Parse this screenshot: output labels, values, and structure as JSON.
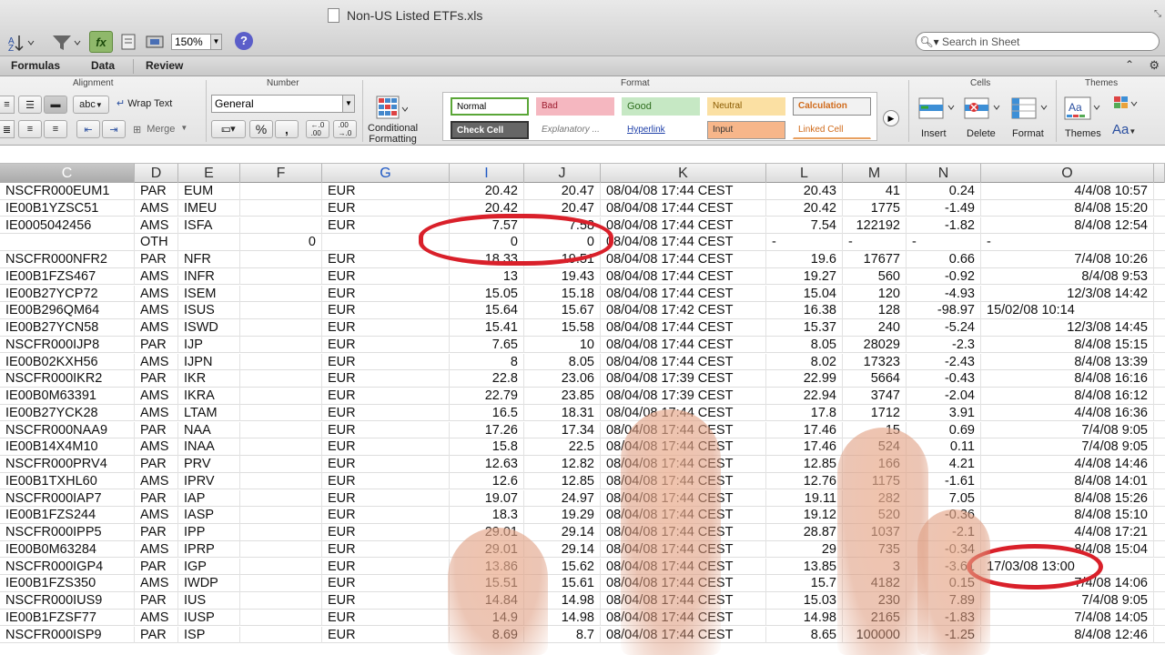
{
  "window": {
    "title": "Non-US Listed ETFs.xls"
  },
  "toolbar": {
    "zoom": "150%",
    "help": "?"
  },
  "search": {
    "placeholder": "Search in Sheet"
  },
  "tabs": [
    "Formulas",
    "Data",
    "Review"
  ],
  "ribbon": {
    "groups": {
      "alignment": "Alignment",
      "number": "Number",
      "format": "Format",
      "cells": "Cells",
      "themes": "Themes"
    },
    "wrap_text": "Wrap Text",
    "merge": "Merge",
    "abc": "abc",
    "number_format": "General",
    "percent": "%",
    "comma": ",",
    "conditional_formatting": [
      "Conditional",
      "Formatting"
    ],
    "styles": {
      "normal": "Normal",
      "bad": "Bad",
      "good": "Good",
      "neutral": "Neutral",
      "calculation": "Calculation",
      "check_cell": "Check Cell",
      "explanatory": "Explanatory ...",
      "hyperlink": "Hyperlink",
      "input": "Input",
      "linked_cell": "Linked Cell"
    },
    "insert": "Insert",
    "delete": "Delete",
    "format_btn": "Format",
    "themes_btn": "Themes",
    "fonts_btn": "Aa"
  },
  "columns": [
    "C",
    "D",
    "E",
    "F",
    "G",
    "I",
    "J",
    "K",
    "L",
    "M",
    "N",
    "O"
  ],
  "rows": [
    [
      "NSCFR000EUM1",
      "PAR",
      "EUM",
      "",
      "EUR",
      "20.42",
      "20.47",
      "08/04/08 17:44 CEST",
      "20.43",
      "41",
      "0.24",
      "4/4/08 10:57"
    ],
    [
      "IE00B1YZSC51",
      "AMS",
      "IMEU",
      "",
      "EUR",
      "20.42",
      "20.47",
      "08/04/08 17:44 CEST",
      "20.42",
      "1775",
      "-1.49",
      "8/4/08 15:20"
    ],
    [
      "IE0005042456",
      "AMS",
      "ISFA",
      "",
      "EUR",
      "7.57",
      "7.58",
      "08/04/08 17:44 CEST",
      "7.54",
      "122192",
      "-1.82",
      "8/4/08 12:54"
    ],
    [
      "",
      "OTH",
      "",
      "0",
      "",
      "0",
      "0",
      "08/04/08 17:44 CEST",
      "-",
      "-",
      "-",
      "-"
    ],
    [
      "NSCFR000NFR2",
      "PAR",
      "NFR",
      "",
      "EUR",
      "18.33",
      "19.51",
      "08/04/08 17:44 CEST",
      "19.6",
      "17677",
      "0.66",
      "7/4/08 10:26"
    ],
    [
      "IE00B1FZS467",
      "AMS",
      "INFR",
      "",
      "EUR",
      "13",
      "19.43",
      "08/04/08 17:44 CEST",
      "19.27",
      "560",
      "-0.92",
      "8/4/08 9:53"
    ],
    [
      "IE00B27YCP72",
      "AMS",
      "ISEM",
      "",
      "EUR",
      "15.05",
      "15.18",
      "08/04/08 17:44 CEST",
      "15.04",
      "120",
      "-4.93",
      "12/3/08 14:42"
    ],
    [
      "IE00B296QM64",
      "AMS",
      "ISUS",
      "",
      "EUR",
      "15.64",
      "15.67",
      "08/04/08 17:42 CEST",
      "16.38",
      "128",
      "-98.97",
      "15/02/08 10:14"
    ],
    [
      "IE00B27YCN58",
      "AMS",
      "ISWD",
      "",
      "EUR",
      "15.41",
      "15.58",
      "08/04/08 17:44 CEST",
      "15.37",
      "240",
      "-5.24",
      "12/3/08 14:45"
    ],
    [
      "NSCFR000IJP8",
      "PAR",
      "IJP",
      "",
      "EUR",
      "7.65",
      "10",
      "08/04/08 17:44 CEST",
      "8.05",
      "28029",
      "-2.3",
      "8/4/08 15:15"
    ],
    [
      "IE00B02KXH56",
      "AMS",
      "IJPN",
      "",
      "EUR",
      "8",
      "8.05",
      "08/04/08 17:44 CEST",
      "8.02",
      "17323",
      "-2.43",
      "8/4/08 13:39"
    ],
    [
      "NSCFR000IKR2",
      "PAR",
      "IKR",
      "",
      "EUR",
      "22.8",
      "23.06",
      "08/04/08 17:39 CEST",
      "22.99",
      "5664",
      "-0.43",
      "8/4/08 16:16"
    ],
    [
      "IE00B0M63391",
      "AMS",
      "IKRA",
      "",
      "EUR",
      "22.79",
      "23.85",
      "08/04/08 17:39 CEST",
      "22.94",
      "3747",
      "-2.04",
      "8/4/08 16:12"
    ],
    [
      "IE00B27YCK28",
      "AMS",
      "LTAM",
      "",
      "EUR",
      "16.5",
      "18.31",
      "08/04/08 17:44 CEST",
      "17.8",
      "1712",
      "3.91",
      "4/4/08 16:36"
    ],
    [
      "NSCFR000NAA9",
      "PAR",
      "NAA",
      "",
      "EUR",
      "17.26",
      "17.34",
      "08/04/08 17:44 CEST",
      "17.46",
      "15",
      "0.69",
      "7/4/08 9:05"
    ],
    [
      "IE00B14X4M10",
      "AMS",
      "INAA",
      "",
      "EUR",
      "15.8",
      "22.5",
      "08/04/08 17:44 CEST",
      "17.46",
      "524",
      "0.11",
      "7/4/08 9:05"
    ],
    [
      "NSCFR000PRV4",
      "PAR",
      "PRV",
      "",
      "EUR",
      "12.63",
      "12.82",
      "08/04/08 17:44 CEST",
      "12.85",
      "166",
      "4.21",
      "4/4/08 14:46"
    ],
    [
      "IE00B1TXHL60",
      "AMS",
      "IPRV",
      "",
      "EUR",
      "12.6",
      "12.85",
      "08/04/08 17:44 CEST",
      "12.76",
      "1175",
      "-1.61",
      "8/4/08 14:01"
    ],
    [
      "NSCFR000IAP7",
      "PAR",
      "IAP",
      "",
      "EUR",
      "19.07",
      "24.97",
      "08/04/08 17:44 CEST",
      "19.11",
      "282",
      "7.05",
      "8/4/08 15:26"
    ],
    [
      "IE00B1FZS244",
      "AMS",
      "IASP",
      "",
      "EUR",
      "18.3",
      "19.29",
      "08/04/08 17:44 CEST",
      "19.12",
      "520",
      "-0.36",
      "8/4/08 15:10"
    ],
    [
      "NSCFR000IPP5",
      "PAR",
      "IPP",
      "",
      "EUR",
      "29.01",
      "29.14",
      "08/04/08 17:44 CEST",
      "28.87",
      "1037",
      "-2.1",
      "4/4/08 17:21"
    ],
    [
      "IE00B0M63284",
      "AMS",
      "IPRP",
      "",
      "EUR",
      "29.01",
      "29.14",
      "08/04/08 17:44 CEST",
      "29",
      "735",
      "-0.34",
      "8/4/08 15:04"
    ],
    [
      "NSCFR000IGP4",
      "PAR",
      "IGP",
      "",
      "EUR",
      "13.86",
      "15.62",
      "08/04/08 17:44 CEST",
      "13.85",
      "3",
      "-3.61",
      "17/03/08 13:00"
    ],
    [
      "IE00B1FZS350",
      "AMS",
      "IWDP",
      "",
      "EUR",
      "15.51",
      "15.61",
      "08/04/08 17:44 CEST",
      "15.7",
      "4182",
      "0.15",
      "7/4/08 14:06"
    ],
    [
      "NSCFR000IUS9",
      "PAR",
      "IUS",
      "",
      "EUR",
      "14.84",
      "14.98",
      "08/04/08 17:44 CEST",
      "15.03",
      "230",
      "7.89",
      "7/4/08 9:05"
    ],
    [
      "IE00B1FZSF77",
      "AMS",
      "IUSP",
      "",
      "EUR",
      "14.9",
      "14.98",
      "08/04/08 17:44 CEST",
      "14.98",
      "2165",
      "-1.83",
      "7/4/08 14:05"
    ],
    [
      "NSCFR000ISP9",
      "PAR",
      "ISP",
      "",
      "EUR",
      "8.69",
      "8.7",
      "08/04/08 17:44 CEST",
      "8.65",
      "100000",
      "-1.25",
      "8/4/08 12:46"
    ]
  ],
  "colors": {
    "annotation": "#d9202a",
    "selected_header": "#a9a9a9",
    "accent_blue": "#1e58c4"
  }
}
